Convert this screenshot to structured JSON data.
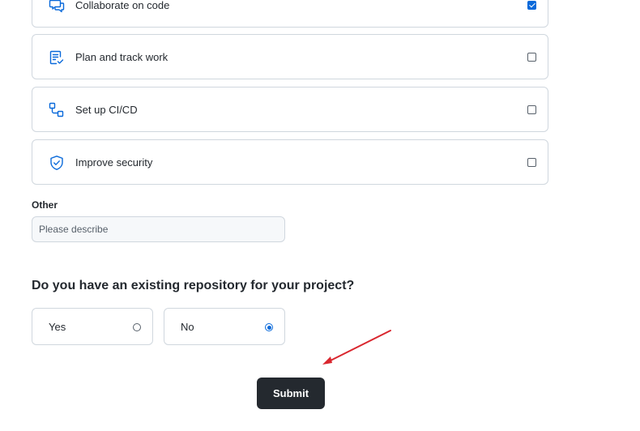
{
  "goals": [
    {
      "label": "Collaborate on code",
      "icon": "code-review-icon",
      "checked": true
    },
    {
      "label": "Plan and track work",
      "icon": "project-icon",
      "checked": false
    },
    {
      "label": "Set up CI/CD",
      "icon": "workflow-icon",
      "checked": false
    },
    {
      "label": "Improve security",
      "icon": "shield-check-icon",
      "checked": false
    }
  ],
  "other": {
    "label": "Other",
    "placeholder": "Please describe",
    "value": ""
  },
  "repository_question": {
    "text": "Do you have an existing repository for your project?",
    "options": [
      {
        "label": "Yes",
        "selected": false
      },
      {
        "label": "No",
        "selected": true
      }
    ]
  },
  "submit": {
    "label": "Submit"
  },
  "colors": {
    "accent": "#0969da",
    "border": "#d0d7de",
    "button_bg": "#24292f",
    "annotation_arrow": "#d9262e"
  }
}
